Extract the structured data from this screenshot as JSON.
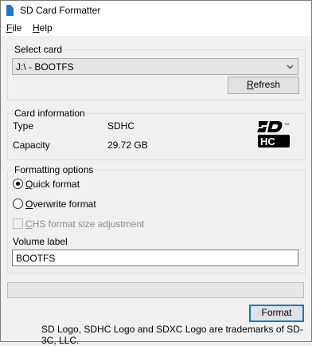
{
  "window": {
    "title": "SD Card Formatter"
  },
  "menu": {
    "file_rest": "ile",
    "file_key": "F",
    "help_rest": "elp",
    "help_key": "H"
  },
  "select_card": {
    "title": "Select card",
    "selected": "J:\\ - BOOTFS",
    "refresh_key": "R",
    "refresh_rest": "efresh"
  },
  "card_info": {
    "title": "Card information",
    "type_label": "Type",
    "type_value": "SDHC",
    "capacity_label": "Capacity",
    "capacity_value": "29.72 GB",
    "logo_icon": "sdhc-logo-icon"
  },
  "formatting": {
    "title": "Formatting options",
    "quick_key": "Q",
    "quick_rest": "uick format",
    "quick_checked": true,
    "overwrite_key": "O",
    "overwrite_rest": "verwrite format",
    "overwrite_checked": false,
    "chs_key": "C",
    "chs_rest": "HS format size adjustment",
    "chs_enabled": false,
    "volume_label_caption": "Volume label",
    "volume_label_value": "BOOTFS"
  },
  "progress": {
    "fraction": 0
  },
  "actions": {
    "format_label": "Format"
  },
  "footer": {
    "trademark": "SD Logo, SDHC Logo and SDXC Logo are trademarks of SD-3C, LLC."
  },
  "colors": {
    "accent": "#0078d7",
    "app_icon": "#1b78d4",
    "progress_fill": "#06b025"
  }
}
